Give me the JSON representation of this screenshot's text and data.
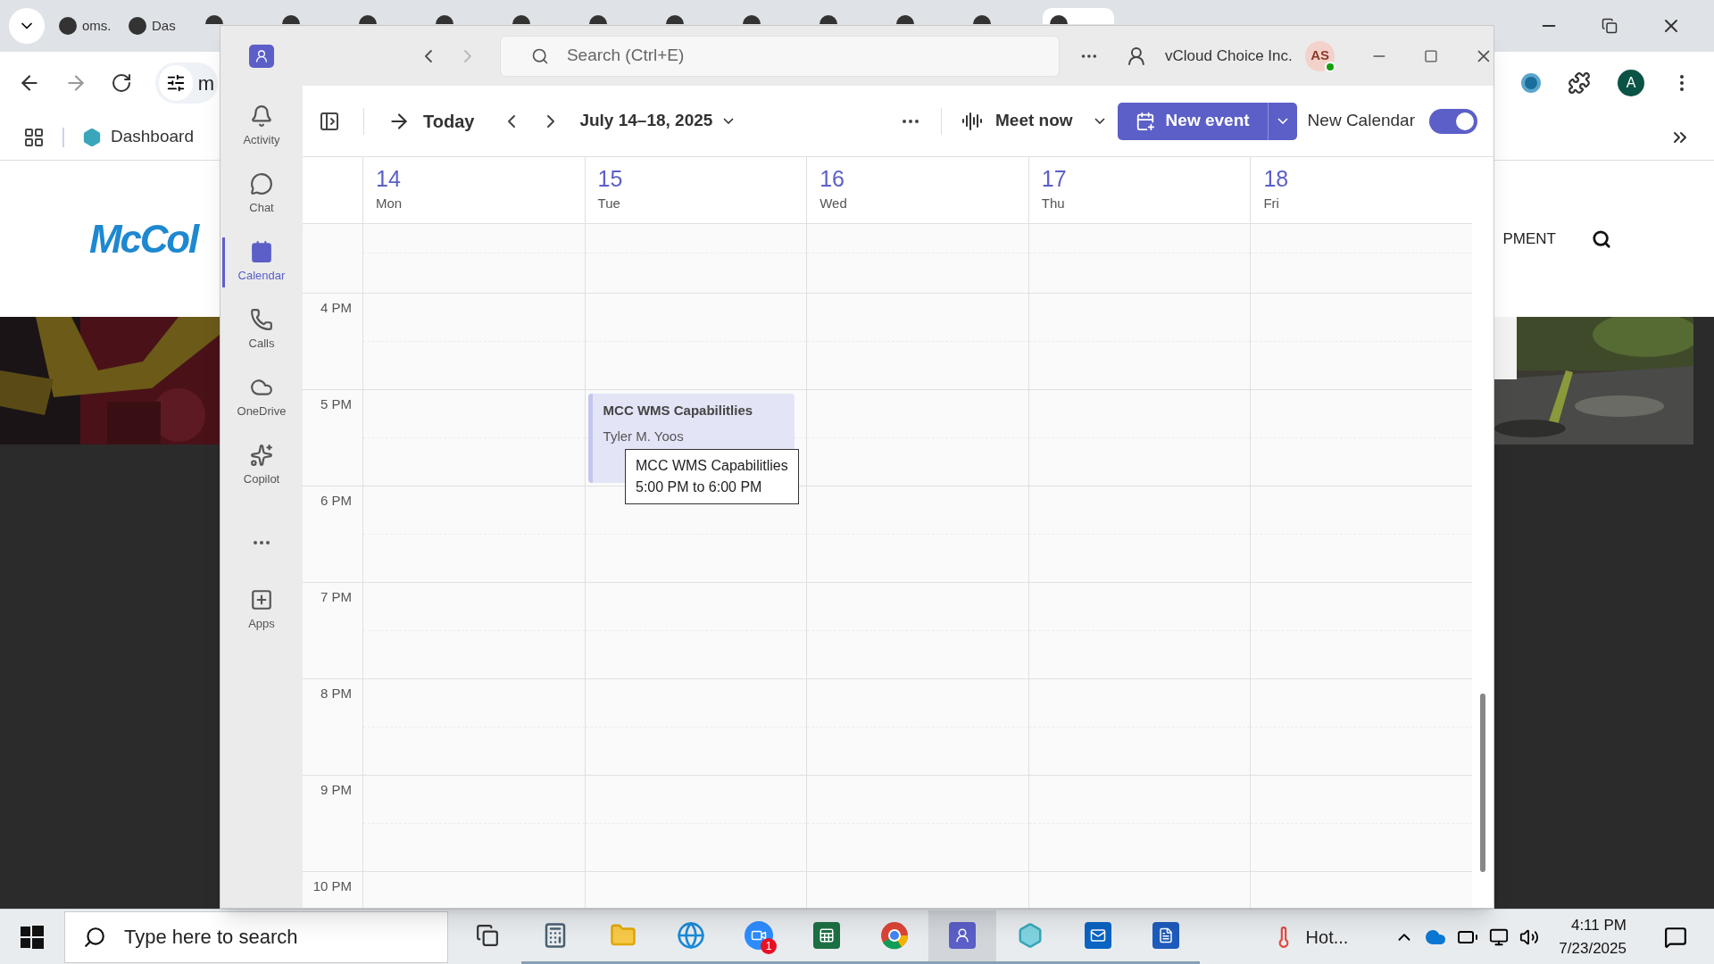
{
  "browser": {
    "tabs": [
      {
        "title": "oms.",
        "selected": false
      },
      {
        "title": "Das",
        "selected": false
      },
      {
        "selected": false
      },
      {
        "selected": false
      },
      {
        "selected": false
      },
      {
        "selected": false
      },
      {
        "selected": false
      },
      {
        "selected": false
      },
      {
        "selected": false
      },
      {
        "selected": false
      },
      {
        "selected": false
      },
      {
        "selected": false
      },
      {
        "selected": false
      },
      {
        "selected": true
      }
    ],
    "address_text": "m",
    "profile": "A",
    "bookmarks": [
      {
        "label": "Dashboard"
      }
    ],
    "page": {
      "logo_text": "McCol",
      "nav_text": "PMENT"
    }
  },
  "teams": {
    "search": {
      "placeholder": "Search (Ctrl+E)"
    },
    "org": "vCloud Choice Inc.",
    "avatar": "AS",
    "rail": [
      {
        "label": "Activity",
        "kind": "activity",
        "selected": false
      },
      {
        "label": "Chat",
        "kind": "chat",
        "selected": false
      },
      {
        "label": "Calendar",
        "kind": "calendar",
        "selected": true
      },
      {
        "label": "Calls",
        "kind": "calls",
        "selected": false
      },
      {
        "label": "OneDrive",
        "kind": "onedrive",
        "selected": false
      },
      {
        "label": "Copilot",
        "kind": "copilot",
        "selected": false
      },
      {
        "kind": "more"
      },
      {
        "label": "Apps",
        "kind": "apps",
        "selected": false
      }
    ],
    "toolbar": {
      "today": "Today",
      "range": "July 14–18, 2025",
      "meet_now": "Meet now",
      "new_event": "New event",
      "new_calendar": "New Calendar",
      "new_calendar_on": true
    },
    "days": [
      {
        "number": "14",
        "name": "Mon"
      },
      {
        "number": "15",
        "name": "Tue",
        "events": [
          {
            "title": "MCC WMS Capabilitlies",
            "organizer": "Tyler M. Yoos"
          }
        ]
      },
      {
        "number": "16",
        "name": "Wed"
      },
      {
        "number": "17",
        "name": "Thu"
      },
      {
        "number": "18",
        "name": "Fri"
      }
    ],
    "times": [
      "4 PM",
      "5 PM",
      "6 PM",
      "7 PM",
      "8 PM",
      "9 PM",
      "10 PM"
    ],
    "tooltip": {
      "title": "MCC WMS Capabilitlies",
      "time": "5:00 PM to 6:00 PM"
    }
  },
  "taskbar": {
    "search_placeholder": "Type here to search",
    "apps": [
      {
        "kind": "taskview",
        "selected": false
      },
      {
        "kind": "calculator",
        "selected": false
      },
      {
        "kind": "explorer",
        "selected": false
      },
      {
        "kind": "edge",
        "selected": false
      },
      {
        "kind": "zoom",
        "selected": false,
        "badge": "1"
      },
      {
        "kind": "excel",
        "selected": false
      },
      {
        "kind": "chrome",
        "selected": false
      },
      {
        "kind": "teams",
        "selected": true
      },
      {
        "kind": "app",
        "selected": false
      },
      {
        "kind": "outlook",
        "selected": false
      },
      {
        "kind": "word",
        "selected": false
      }
    ],
    "weather": "Hot...",
    "time": "4:11 PM",
    "date": "7/23/2025"
  }
}
